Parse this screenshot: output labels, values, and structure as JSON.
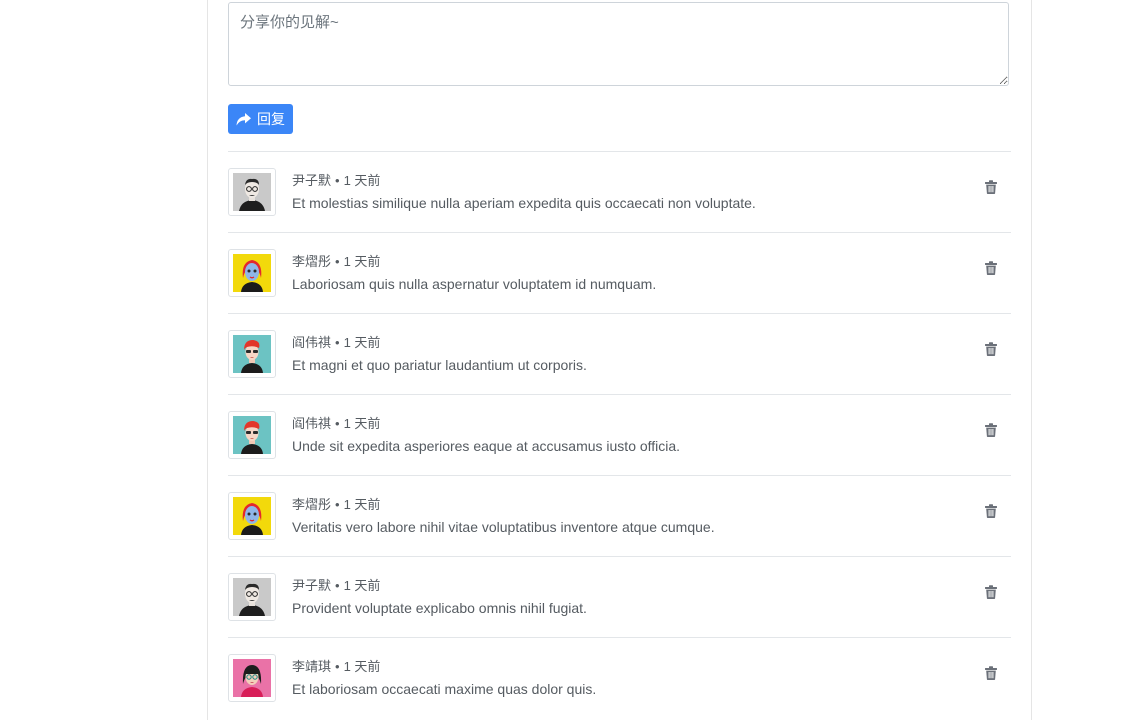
{
  "reply_form": {
    "placeholder": "分享你的见解~",
    "button_label": "回复",
    "button_icon": "reply-arrow-icon",
    "accent_color": "#3b86f7"
  },
  "comments": [
    {
      "author": "尹子默",
      "time": "1 天前",
      "text": "Et molestias similique nulla aperiam expedita quis occaecati non voluptate.",
      "avatar": "avatar-glasses-man-gray"
    },
    {
      "author": "李熠彤",
      "time": "1 天前",
      "text": "Laboriosam quis nulla aspernatur voluptatem id numquam.",
      "avatar": "avatar-red-hair-yellow"
    },
    {
      "author": "阎伟祺",
      "time": "1 天前",
      "text": "Et magni et quo pariatur laudantium ut corporis.",
      "avatar": "avatar-red-hair-teal"
    },
    {
      "author": "阎伟祺",
      "time": "1 天前",
      "text": "Unde sit expedita asperiores eaque at accusamus iusto officia.",
      "avatar": "avatar-red-hair-teal"
    },
    {
      "author": "李熠彤",
      "time": "1 天前",
      "text": "Veritatis vero labore nihil vitae voluptatibus inventore atque cumque.",
      "avatar": "avatar-red-hair-yellow"
    },
    {
      "author": "尹子默",
      "time": "1 天前",
      "text": "Provident voluptate explicabo omnis nihil fugiat.",
      "avatar": "avatar-glasses-man-gray"
    },
    {
      "author": "李靖琪",
      "time": "1 天前",
      "text": "Et laboriosam occaecati maxime quas dolor quis.",
      "avatar": "avatar-woman-pink"
    }
  ],
  "meta_separator": "•",
  "delete_icon": "trash-icon"
}
